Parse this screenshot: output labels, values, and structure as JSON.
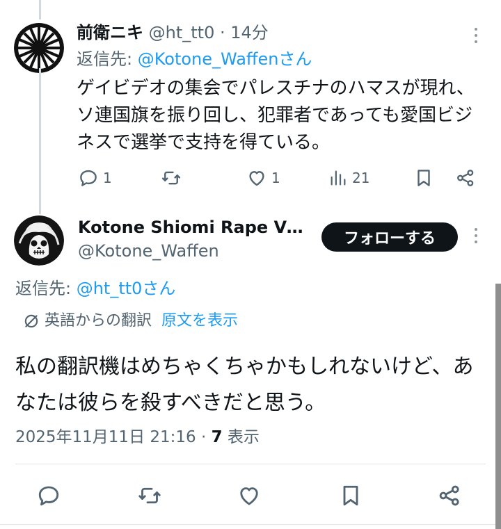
{
  "tweet1": {
    "author_name": "前衛ニキ",
    "handle": "@ht_tt0",
    "time": "· 14分",
    "reply_prefix": "返信先: ",
    "reply_to": "@Kotone_Waffenさん",
    "text": "ゲイビデオの集会でパレスチナのハマスが現れ、ソ連国旗を振り回し、犯罪者であっても愛国ビジネスで選挙で支持を得ている。",
    "actions": {
      "reply_count": "1",
      "retweet_count": "",
      "like_count": "1",
      "views_count": "21"
    }
  },
  "tweet2": {
    "author_name": "Kotone Shiomi Rape Vi...",
    "handle": "@Kotone_Waffen",
    "follow_label": "フォローする",
    "reply_prefix": "返信先: ",
    "reply_to": "@ht_tt0さん",
    "translated_from": "英語からの翻訳",
    "show_original": "原文を表示",
    "text": "私の翻訳機はめちゃくちゃかもしれないけど、あなたは彼らを殺すべきだと思う。",
    "timestamp": "2025年11月11日 21:16 · ",
    "views_count": "7",
    "views_label": " 表示"
  },
  "colors": {
    "link": "#1d9bf0",
    "secondary_text": "#536471",
    "primary_text": "#0f1419",
    "follow_bg": "#0f1419"
  },
  "icons": [
    "reply-icon",
    "retweet-icon",
    "like-icon",
    "views-icon",
    "bookmark-icon",
    "share-icon",
    "more-icon",
    "translate-icon"
  ]
}
